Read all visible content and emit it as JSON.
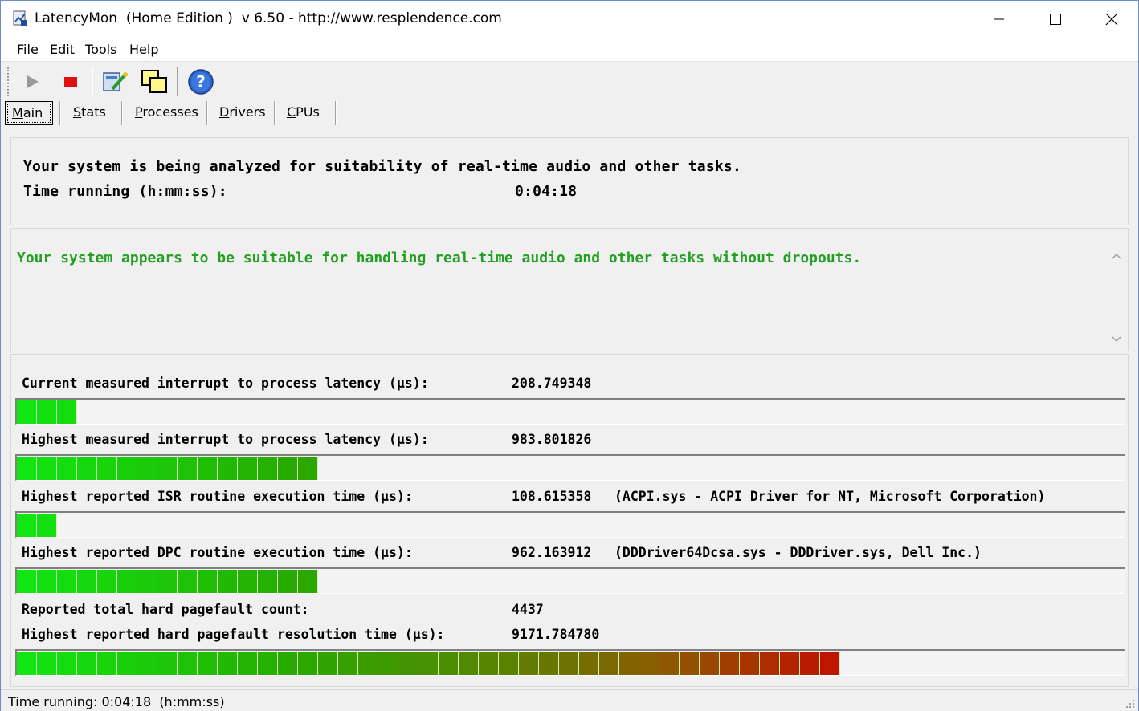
{
  "window": {
    "title": "LatencyMon  (Home Edition )  v 6.50 - http://www.resplendence.com"
  },
  "menu": {
    "file": {
      "u": "F",
      "rest": "ile"
    },
    "edit": {
      "u": "E",
      "rest": "dit"
    },
    "tools": {
      "u": "T",
      "rest": "ools"
    },
    "help": {
      "u": "H",
      "rest": "elp"
    }
  },
  "toolbar": {
    "start_icon": "play-icon",
    "stop_icon": "stop-icon",
    "driver_icon": "driver-tool-icon",
    "windows_icon": "windows-icon",
    "help_icon": "help-icon"
  },
  "tabs": [
    {
      "u": "M",
      "rest": "ain"
    },
    {
      "u": "S",
      "rest": "tats"
    },
    {
      "u": "P",
      "rest": "rocesses"
    },
    {
      "u": "D",
      "rest": "rivers"
    },
    {
      "u": "C",
      "rest": "PUs"
    }
  ],
  "analysis": {
    "message": "Your system is being analyzed for suitability of real-time audio and other tasks.",
    "time_label": "Time running (h:mm:ss):",
    "time_value": "0:04:18"
  },
  "verdict": {
    "text": "Your system appears to be suitable for handling real-time audio and other tasks without dropouts.",
    "color": "#22a022"
  },
  "metrics": {
    "current_latency": {
      "label": "Current measured interrupt to process latency (µs):",
      "value": "208.749348",
      "segments": 3
    },
    "highest_latency": {
      "label": "Highest measured interrupt to process latency (µs):",
      "value": "983.801826",
      "segments": 15
    },
    "highest_isr": {
      "label": "Highest reported ISR routine execution time (µs):",
      "value": "108.615358",
      "extra": "(ACPI.sys - ACPI Driver for NT, Microsoft Corporation)",
      "segments": 2
    },
    "highest_dpc": {
      "label": "Highest reported DPC routine execution time (µs):",
      "value": "962.163912",
      "extra": "(DDDriver64Dcsa.sys - DDDriver.sys, Dell Inc.)",
      "segments": 15
    },
    "pagefault_count": {
      "label": "Reported total hard pagefault count:",
      "value": "4437"
    },
    "pagefault_time": {
      "label": "Highest reported hard pagefault resolution time (µs):",
      "value": "9171.784780",
      "segments": 41
    }
  },
  "status": {
    "text": "Time running: 0:04:18  (h:mm:ss)"
  }
}
